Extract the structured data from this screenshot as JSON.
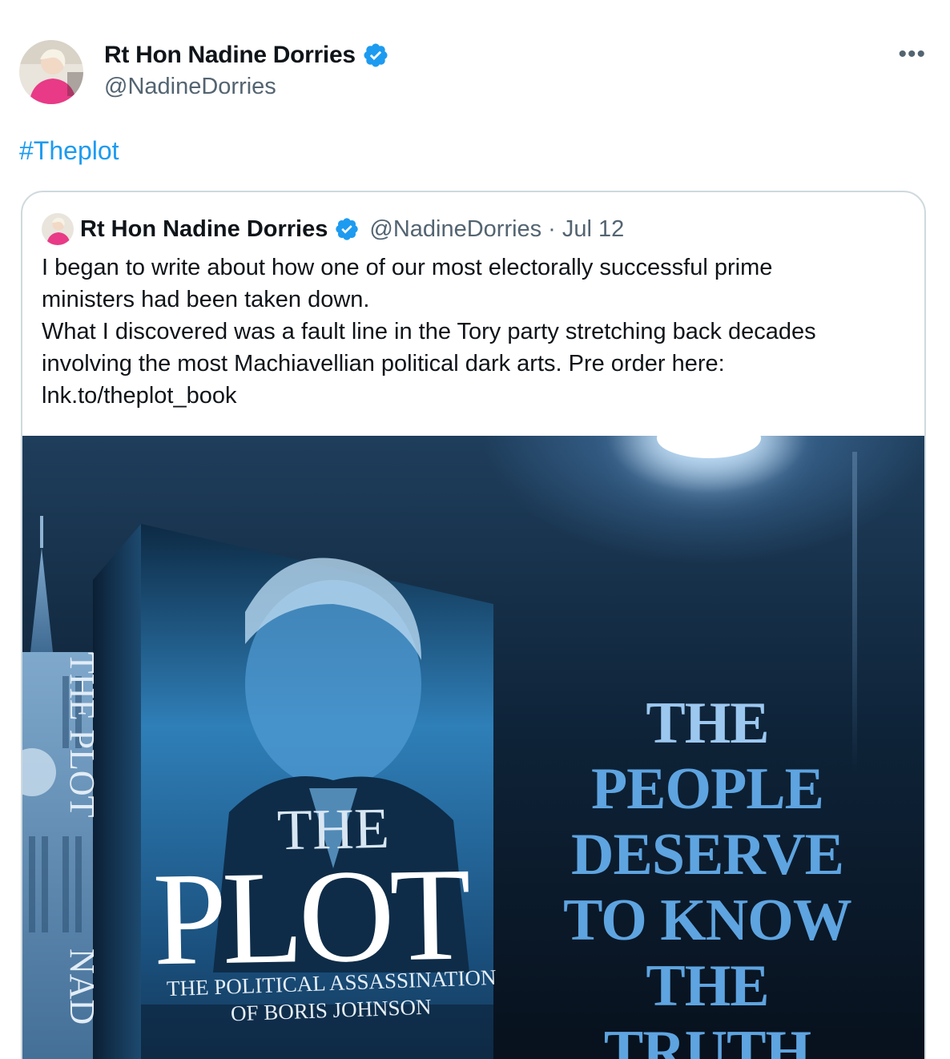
{
  "tweet": {
    "author": {
      "display_name": "Rt Hon Nadine Dorries",
      "handle": "@NadineDorries",
      "verified": true
    },
    "more_icon": "more-horizontal-icon",
    "hashtag": "#Theplot",
    "quoted": {
      "author": {
        "display_name": "Rt Hon Nadine Dorries",
        "handle": "@NadineDorries",
        "verified": true
      },
      "separator": "·",
      "date": "Jul 12",
      "text_lines": [
        "I began to write about how one of our most electorally successful prime",
        "ministers had been taken down.",
        "What I discovered was a fault line in the Tory party stretching back decades",
        "involving the most Machiavellian political dark arts. Pre order here:",
        "lnk.to/theplot_book"
      ],
      "media": {
        "book_cover": {
          "title_small": "THE",
          "title_large": "PLOT",
          "subtitle_line1": "THE POLITICAL ASSASSINATION",
          "subtitle_line2": "OF BORIS JOHNSON",
          "spine_title": "THE PLOT",
          "spine_author": "NAD"
        },
        "slogan_lines": [
          "THE",
          "PEOPLE",
          "DESERVE",
          "TO KNOW",
          "THE",
          "TRUTH"
        ]
      }
    }
  },
  "colors": {
    "link": "#1d9bf0",
    "verified": "#1d9bf0",
    "secondary_text": "#536471",
    "border": "#cfd9de"
  }
}
